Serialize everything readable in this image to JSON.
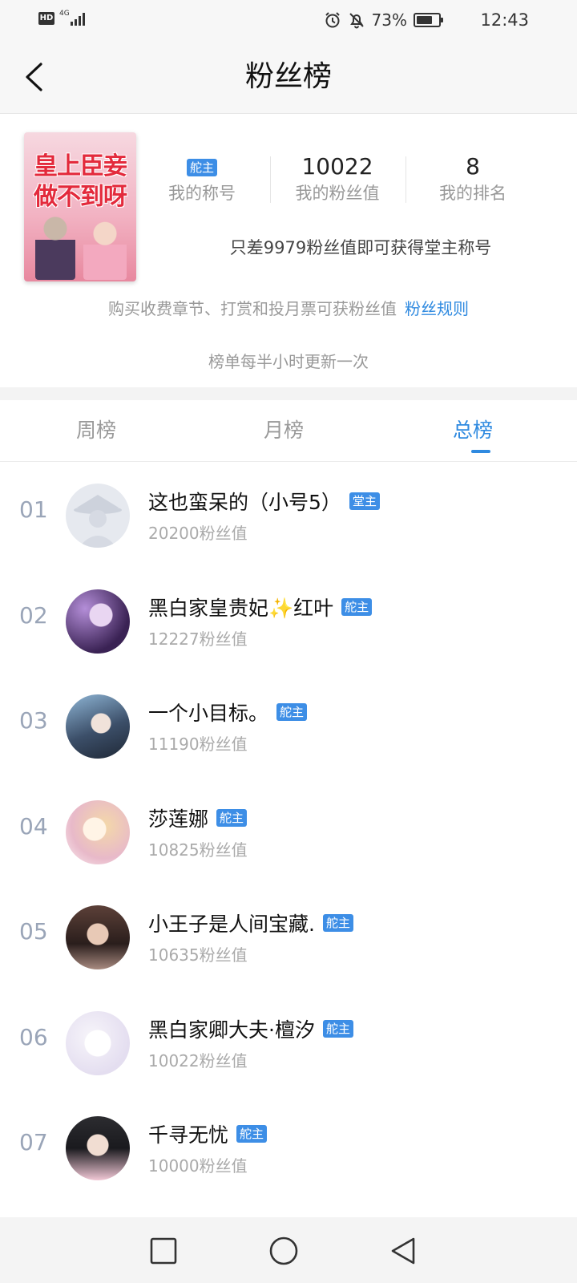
{
  "status_bar": {
    "hd": "HD",
    "network": "4G",
    "battery": "73%",
    "battery_level": 0.73,
    "time": "12:43"
  },
  "header": {
    "title": "粉丝榜"
  },
  "profile": {
    "cover_title": "皇上臣妾做不到呀",
    "my_title_badge": "舵主",
    "my_title_label": "我的称号",
    "fan_value": "10022",
    "fan_value_label": "我的粉丝值",
    "rank": "8",
    "rank_label": "我的排名",
    "promo": "只差9979粉丝值即可获得堂主称号",
    "rules_text": "购买收费章节、打赏和投月票可获粉丝值",
    "rules_link": "粉丝规则",
    "update_note": "榜单每半小时更新一次"
  },
  "tabs": [
    {
      "label": "周榜",
      "active": false
    },
    {
      "label": "月榜",
      "active": false
    },
    {
      "label": "总榜",
      "active": true
    }
  ],
  "fans": [
    {
      "rank": "01",
      "name": "这也蛮呆的（小号5）",
      "badge": "堂主",
      "value": "20200粉丝值"
    },
    {
      "rank": "02",
      "name": "黑白家皇贵妃✨红叶",
      "badge": "舵主",
      "value": "12227粉丝值"
    },
    {
      "rank": "03",
      "name": "一个小目标。",
      "badge": "舵主",
      "value": "11190粉丝值"
    },
    {
      "rank": "04",
      "name": "莎莲娜",
      "badge": "舵主",
      "value": "10825粉丝值"
    },
    {
      "rank": "05",
      "name": "小王子是人间宝藏.",
      "badge": "舵主",
      "value": "10635粉丝值"
    },
    {
      "rank": "06",
      "name": "黑白家卿大夫·檀汐",
      "badge": "舵主",
      "value": "10022粉丝值"
    },
    {
      "rank": "07",
      "name": "千寻无忧",
      "badge": "舵主",
      "value": "10000粉丝值"
    }
  ],
  "colors": {
    "accent": "#2f8ae0",
    "badge": "#3d8ee6"
  }
}
